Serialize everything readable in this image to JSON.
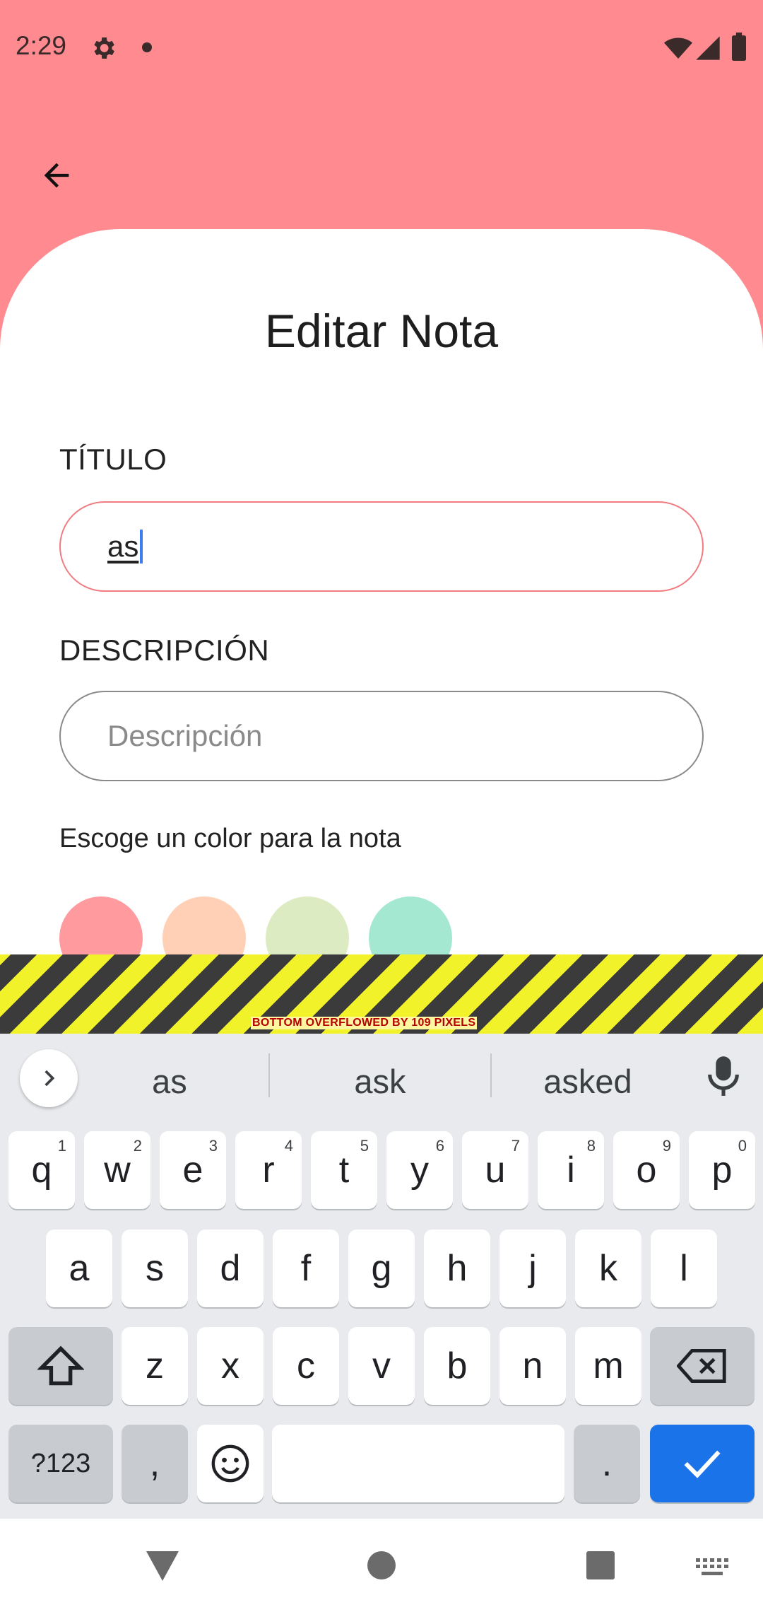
{
  "status": {
    "time": "2:29"
  },
  "header": {
    "title": "Editar Nota"
  },
  "form": {
    "title_label": "TÍTULO",
    "title_value": "as",
    "description_label": "DESCRIPCIÓN",
    "description_placeholder": "Descripción",
    "color_prompt": "Escoge un color para la nota"
  },
  "colors": [
    "#FF9A9E",
    "#FFD0B5",
    "#DDEBC2",
    "#A5E8D2"
  ],
  "overflow_warning": "BOTTOM OVERFLOWED BY 109 PIXELS",
  "keyboard": {
    "suggestions": [
      "as",
      "ask",
      "asked"
    ],
    "row1": [
      "q",
      "w",
      "e",
      "r",
      "t",
      "y",
      "u",
      "i",
      "o",
      "p"
    ],
    "row1_hints": [
      "1",
      "2",
      "3",
      "4",
      "5",
      "6",
      "7",
      "8",
      "9",
      "0"
    ],
    "row2": [
      "a",
      "s",
      "d",
      "f",
      "g",
      "h",
      "j",
      "k",
      "l"
    ],
    "row3": [
      "z",
      "x",
      "c",
      "v",
      "b",
      "n",
      "m"
    ],
    "symbols_key": "?123",
    "comma_key": ",",
    "period_key": "."
  }
}
